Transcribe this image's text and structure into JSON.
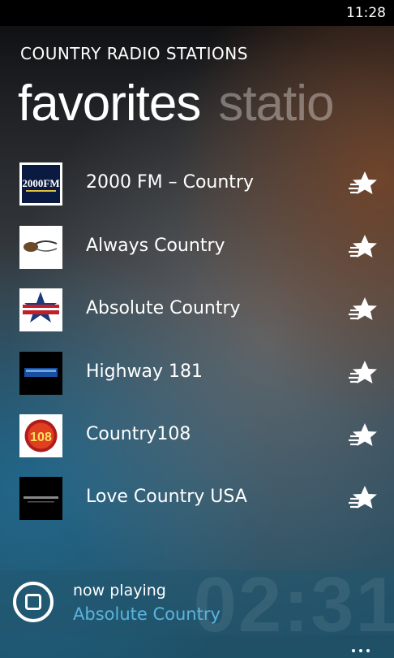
{
  "status_bar": {
    "time": "11:28"
  },
  "app": {
    "title": "COUNTRY RADIO STATIONS"
  },
  "pivot": {
    "tabs": [
      {
        "label": "favorites",
        "active": true
      },
      {
        "label": "statio",
        "active": false
      }
    ]
  },
  "stations": [
    {
      "name": "2000 FM – Country",
      "logo_text": "2000FM",
      "favorite": true
    },
    {
      "name": "Always Country",
      "logo_text": "",
      "favorite": true
    },
    {
      "name": "Absolute Country",
      "logo_text": "",
      "favorite": true
    },
    {
      "name": "Highway 181",
      "logo_text": "",
      "favorite": true
    },
    {
      "name": "Country108",
      "logo_text": "108",
      "favorite": true
    },
    {
      "name": "Love Country USA",
      "logo_text": "",
      "favorite": true
    }
  ],
  "now_playing": {
    "label": "now playing",
    "station": "Absolute Country",
    "elapsed": "02:31"
  },
  "colors": {
    "accent": "#5ab4dc",
    "status_bar": "#000000"
  },
  "icons": {
    "stop": "stop-circle-icon",
    "favorite": "star-icon",
    "more": "ellipsis-icon"
  }
}
